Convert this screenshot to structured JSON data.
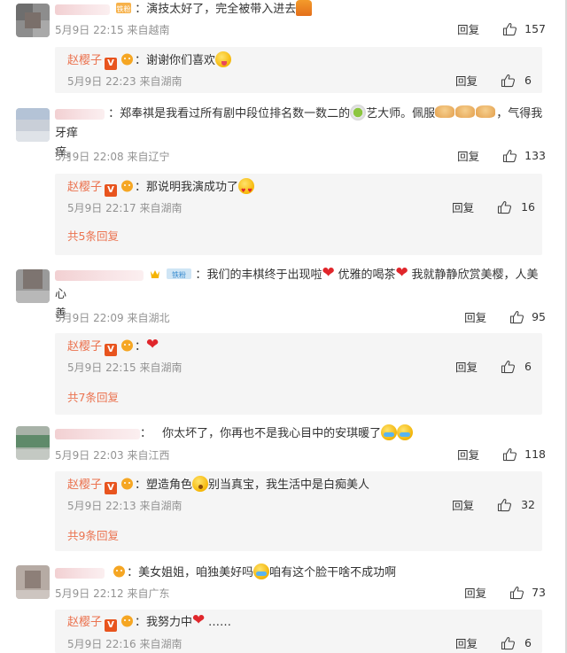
{
  "colors": {
    "author": "#eb7350",
    "meta": "#939393",
    "reply_box_bg": "#f5f5f5",
    "vip_badge": "#e8541e"
  },
  "common": {
    "reply_label": "回复",
    "like_icon": "thumbs-up-icon",
    "author_name": "赵樱子",
    "author_vip": "V",
    "colon": "："
  },
  "comments": [
    {
      "fan_badge": "铁粉",
      "text": "演技太好了，完全被带入进去",
      "text_emoji": "shopping-bag-emoji",
      "time": "5月9日 22:15",
      "location": "来自越南",
      "likes": "157",
      "reply": {
        "text": "谢谢你们喜欢",
        "emoji": "tongue-out-emoji",
        "time": "5月9日 22:23",
        "location": "来自湖南",
        "likes": "6"
      }
    },
    {
      "text_part1": "郑奉祺是我看过所有剧中段位排名数一数二的",
      "text_part2": "艺大师。佩服",
      "text_part3": "，气得我牙痒",
      "text_line2": "痒。",
      "time": "5月9日 22:08",
      "location": "来自辽宁",
      "likes": "133",
      "reply": {
        "text": "那说明我演成功了",
        "emoji": "heart-eyes-emoji",
        "time": "5月9日 22:17",
        "location": "来自湖南",
        "likes": "16"
      },
      "more": "共5条回复"
    },
    {
      "fan_badge": "铁粉",
      "text_part1": "我们的丰棋终于出现啦",
      "text_part2": "优雅的喝茶",
      "text_part3": "我就静静欣赏美樱，人美心",
      "text_line2": "善",
      "time": "5月9日 22:09",
      "location": "来自湖北",
      "likes": "95",
      "reply": {
        "text": "",
        "emoji": "red-heart-emoji",
        "time": "5月9日 22:15",
        "location": "来自湖南",
        "likes": "6"
      },
      "more": "共7条回复"
    },
    {
      "text": "你太坏了，你再也不是我心目中的安琪暖了",
      "time": "5月9日 22:03",
      "location": "来自江西",
      "likes": "118",
      "reply": {
        "text_part1": "塑造角色",
        "text_part2": "别当真宝，我生活中是白痴美人",
        "time": "5月9日 22:13",
        "location": "来自湖南",
        "likes": "32"
      },
      "more": "共9条回复"
    },
    {
      "text_part1": "美女姐姐，咱独美好吗",
      "text_part2": "咱有这个脸干啥不成功啊",
      "time": "5月9日 22:12",
      "location": "来自广东",
      "likes": "73",
      "reply": {
        "text_part1": "我努力中",
        "text_part2": "……",
        "time": "5月9日 22:16",
        "location": "来自湖南",
        "likes": "6"
      }
    }
  ]
}
